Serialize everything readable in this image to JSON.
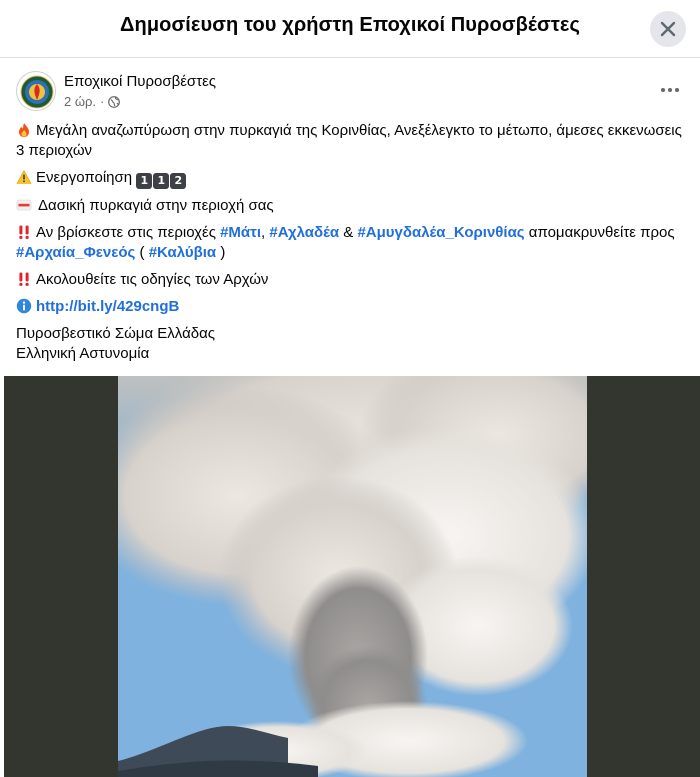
{
  "modal": {
    "title": "Δημοσίευση του χρήστη Εποχικοί Πυροσβέστες",
    "close_icon": "close-icon"
  },
  "post": {
    "author": "Εποχικοί Πυροσβέστες",
    "time": "2 ώρ.",
    "separator": "·",
    "audience_icon": "globe-icon",
    "more_icon": "more-horizontal-icon"
  },
  "content": {
    "line1_icon": "fire-emoji",
    "line1": "Μεγάλη αναζωπύρωση στην πυρκαγιά της Κορινθίας, Ανεξέλεγκτο το μέτωπο, άμεσες εκκενωσεις 3 περιοχών",
    "line2_icon": "warning-emoji",
    "line2": "Ενεργοποίηση",
    "line2_keys": [
      "1",
      "1",
      "2"
    ],
    "line3_icon": "sos-emoji",
    "line3": "Δασική πυρκαγιά στην περιοχή σας",
    "line4_icon": "double-exclamation-emoji",
    "line4_prefix": "Αν βρίσκεστε στις περιοχές",
    "tag_mati": "#Μάτι",
    "comma": ",",
    "tag_achladea": "#Αχλαδέα",
    "ampersand": "&",
    "tag_amygdalea": "#Αμυγδαλέα_Κορινθίας",
    "line4_middle": "απομακρυνθείτε προς",
    "tag_archaia": "#Αρχαία_Φενεός",
    "paren_open": "(",
    "tag_kalyvia": "#Καλύβια",
    "paren_close": ")",
    "line5_icon": "double-exclamation-emoji",
    "line5": "Ακολουθείτε τις οδηγίες των Αρχών",
    "line6_icon": "info-emoji",
    "link": "http://bit.ly/429cngB",
    "sig1": "Πυροσβεστικό Σώμα Ελλάδας",
    "sig2": "Ελληνική Αστυνομία"
  },
  "media": {
    "description_icon": "wildfire-smoke-photo"
  },
  "colors": {
    "link": "#216fdb",
    "meta": "#65676b",
    "media_bg": "#33352f"
  }
}
